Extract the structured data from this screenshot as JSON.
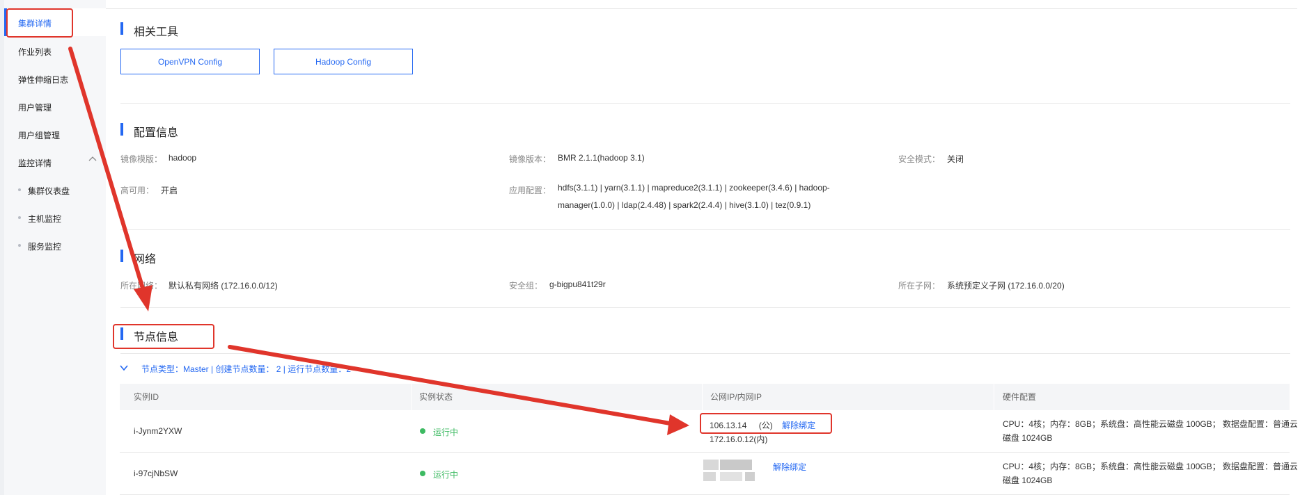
{
  "sidebar": {
    "items": [
      {
        "label": "集群详情"
      },
      {
        "label": "作业列表"
      },
      {
        "label": "弹性伸缩日志"
      },
      {
        "label": "用户管理"
      },
      {
        "label": "用户组管理"
      },
      {
        "label": "监控详情"
      }
    ],
    "sub_items": [
      {
        "label": "集群仪表盘"
      },
      {
        "label": "主机监控"
      },
      {
        "label": "服务监控"
      }
    ]
  },
  "tools": {
    "title": "相关工具",
    "buttons": [
      {
        "label": "OpenVPN Config"
      },
      {
        "label": "Hadoop Config"
      }
    ]
  },
  "config": {
    "title": "配置信息",
    "image_template": {
      "label": "镜像模版：",
      "value": "hadoop"
    },
    "image_version": {
      "label": "镜像版本：",
      "value": "BMR 2.1.1(hadoop 3.1)"
    },
    "security_mode": {
      "label": "安全模式：",
      "value": "关闭"
    },
    "high_availability": {
      "label": "高可用：",
      "value": "开启"
    },
    "app_config": {
      "label": "应用配置：",
      "value": "hdfs(3.1.1) | yarn(3.1.1) | mapreduce2(3.1.1) | zookeeper(3.4.6) | hadoop-manager(1.0.0) | ldap(2.4.48) | spark2(2.4.4) | hive(3.1.0) | tez(0.9.1)"
    }
  },
  "network": {
    "title": "网络",
    "vpc": {
      "label": "所在网络：",
      "value": "默认私有网络 (172.16.0.0/12)"
    },
    "security_group": {
      "label": "安全组：",
      "value": "g-bigpu841t29r"
    },
    "subnet": {
      "label": "所在子网：",
      "value": "系统预定义子网 (172.16.0.0/20)"
    }
  },
  "nodes": {
    "title": "节点信息",
    "group_line": "节点类型：Master | 创建节点数量：  2 | 运行节点数量：2",
    "columns": [
      "实例ID",
      "实例状态",
      "公网IP/内网IP",
      "硬件配置"
    ],
    "rows": [
      {
        "id": "i-Jynm2YXW",
        "status": "运行中",
        "public_ip": "106.13.14",
        "public_suffix": "(公)",
        "unbind": "解除绑定",
        "private_ip": "172.16.0.12(内)",
        "hardware": "CPU：4核；内存：8GB；系统盘：高性能云磁盘 100GB；  数据盘配置：普通云磁盘 1024GB"
      },
      {
        "id": "i-97cjNbSW",
        "status": "运行中",
        "unbind": "解除绑定",
        "hardware": "CPU：4核；内存：8GB；系统盘：高性能云磁盘 100GB；  数据盘配置：普通云磁盘 1024GB"
      }
    ]
  },
  "colors": {
    "accent": "#2468f2",
    "running": "#3dba62",
    "annotation": "#e0352b"
  }
}
